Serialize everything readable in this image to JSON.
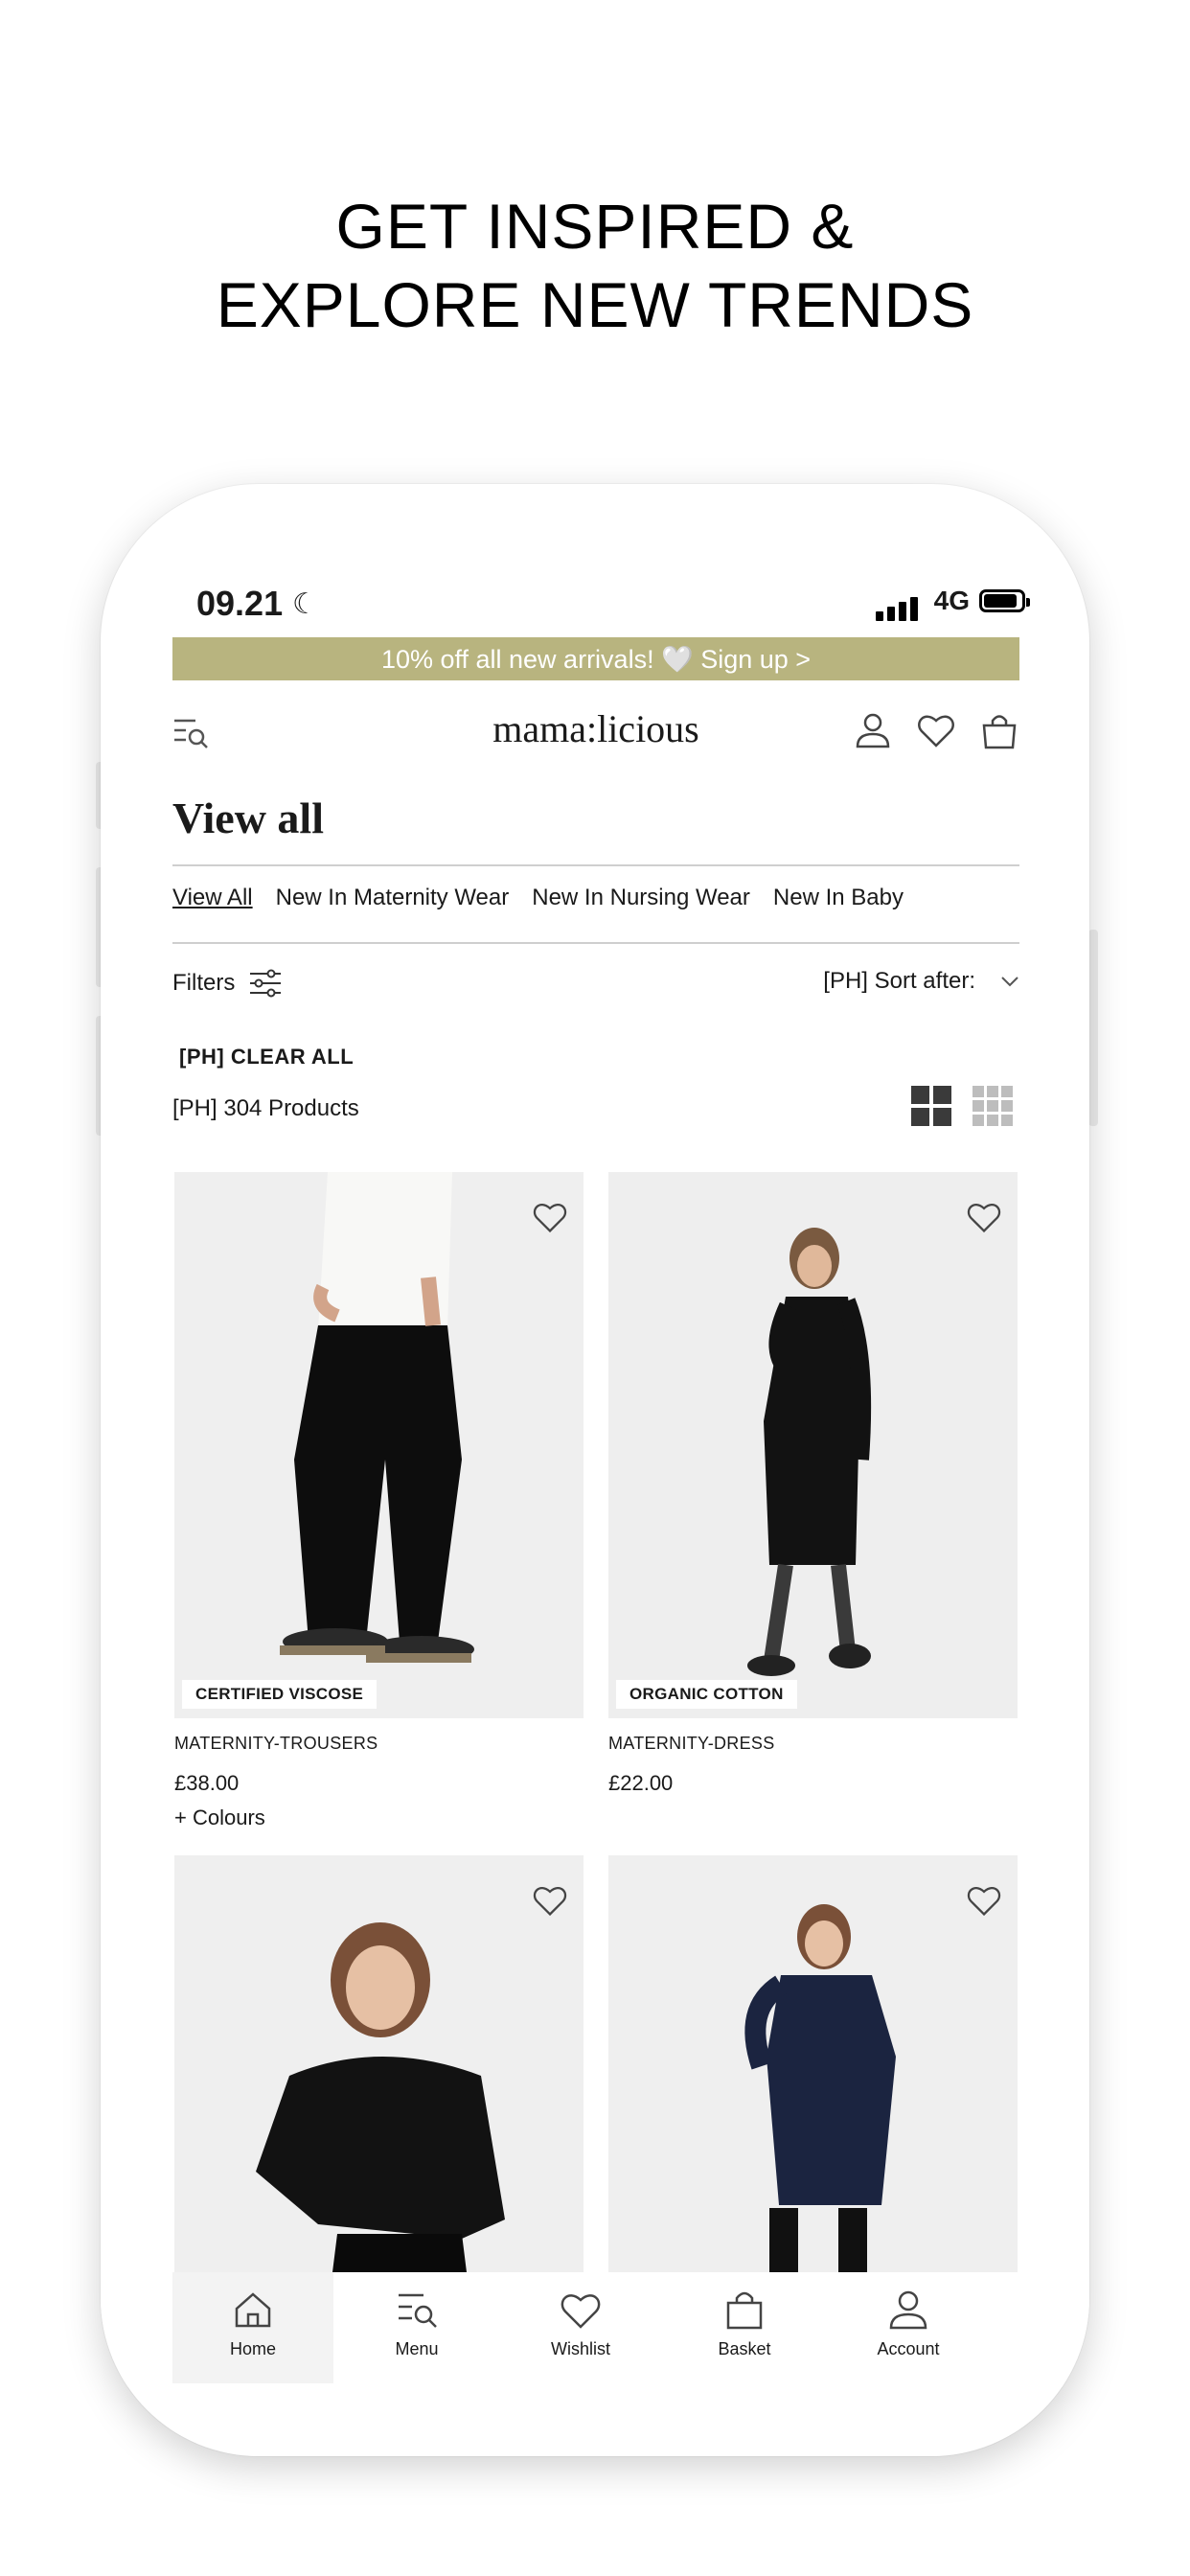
{
  "headline": {
    "line1": "GET INSPIRED &",
    "line2": "EXPLORE NEW TRENDS"
  },
  "status_bar": {
    "time": "09.21",
    "network": "4G"
  },
  "promo_banner": {
    "text": "10% off all new arrivals! 🤍 Sign up >"
  },
  "header": {
    "logo": "mama:licious"
  },
  "page": {
    "title": "View all",
    "categories": [
      {
        "label": "View All",
        "active": true
      },
      {
        "label": "New In Maternity Wear"
      },
      {
        "label": "New In Nursing Wear"
      },
      {
        "label": "New In Baby"
      }
    ],
    "filters_label": "Filters",
    "sort_label": "[PH] Sort after:",
    "clear_all": "[PH] CLEAR ALL",
    "product_count": "[PH] 304 Products"
  },
  "products": [
    {
      "tag": "CERTIFIED VISCOSE",
      "name": "MATERNITY-TROUSERS",
      "price": "£38.00",
      "colours": "+ Colours"
    },
    {
      "tag": "ORGANIC COTTON",
      "name": "MATERNITY-DRESS",
      "price": "£22.00"
    },
    {},
    {}
  ],
  "tabbar": {
    "items": [
      {
        "label": "Home",
        "icon": "home-icon"
      },
      {
        "label": "Menu",
        "icon": "menu-search-icon"
      },
      {
        "label": "Wishlist",
        "icon": "heart-icon"
      },
      {
        "label": "Basket",
        "icon": "bag-icon"
      },
      {
        "label": "Account",
        "icon": "user-icon"
      }
    ]
  },
  "colors": {
    "promo_bg": "#b8b47f",
    "text": "#1a1a1a",
    "card_bg": "#efefef"
  }
}
